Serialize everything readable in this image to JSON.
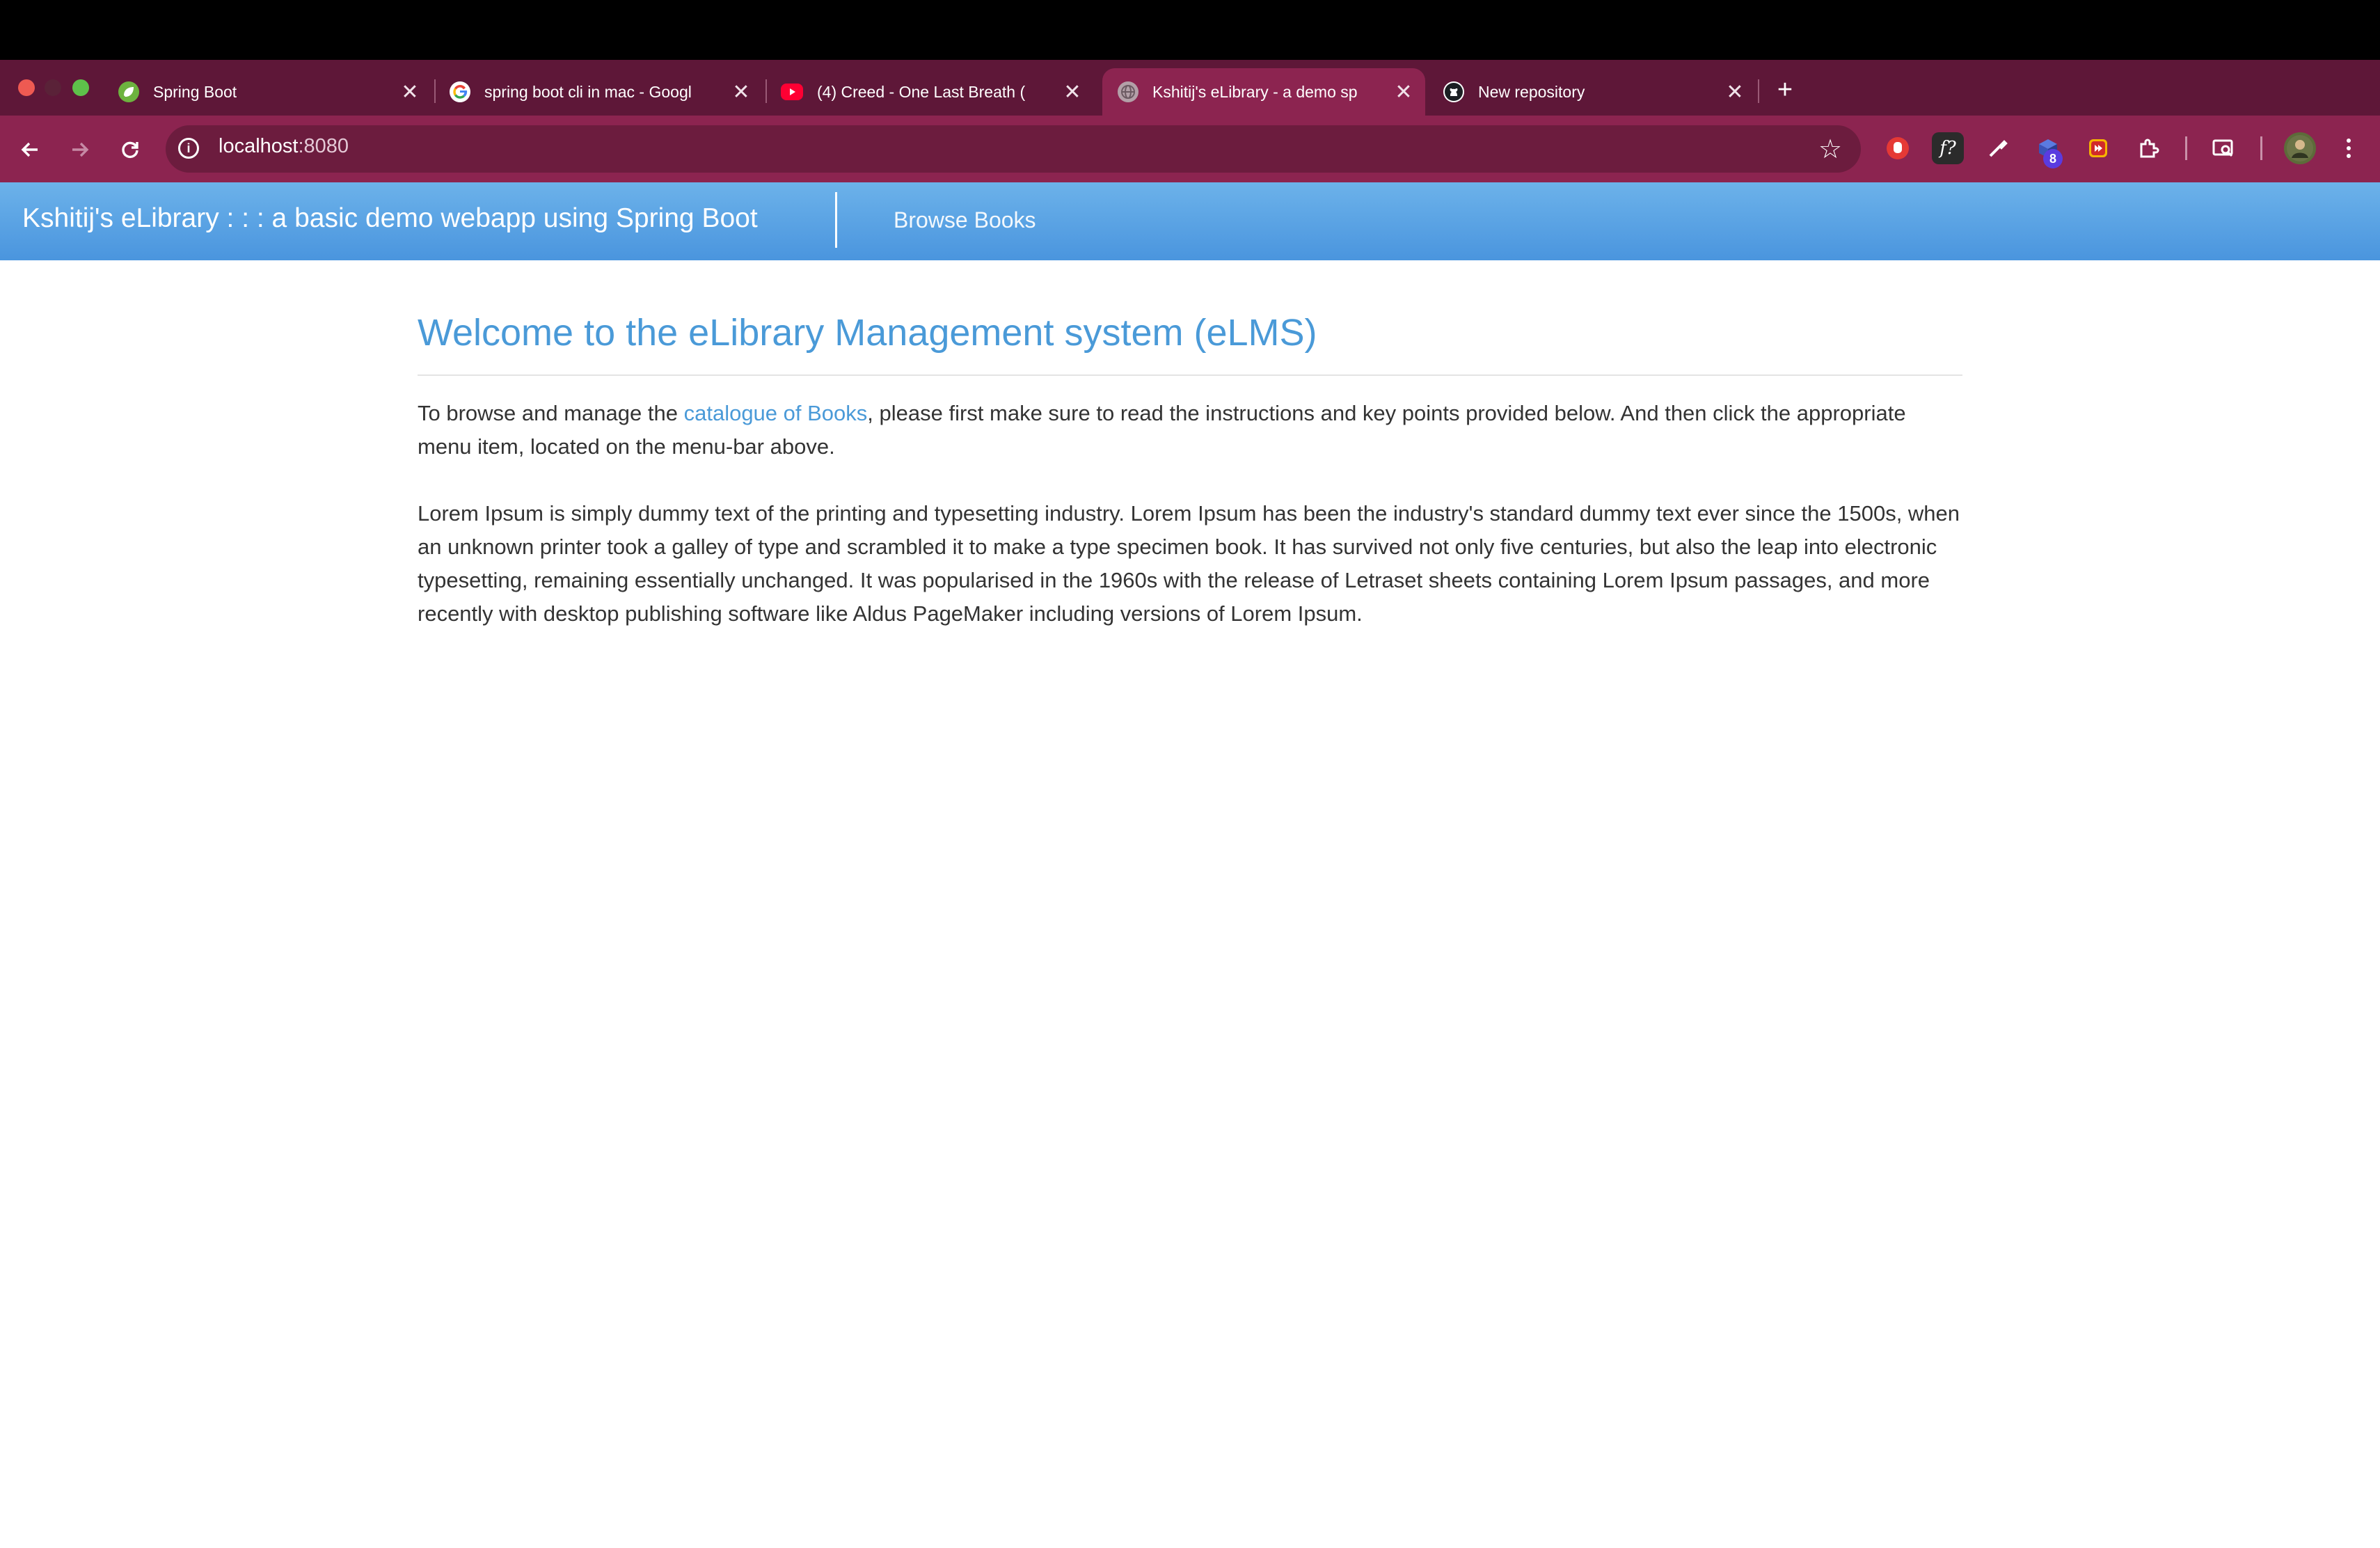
{
  "browser": {
    "tabs": [
      {
        "title": "Spring Boot",
        "favicon": "spring-icon",
        "active": false
      },
      {
        "title": "spring boot cli in mac - Googl",
        "favicon": "google-icon",
        "active": false
      },
      {
        "title": "(4) Creed - One Last Breath (",
        "favicon": "youtube-icon",
        "active": false
      },
      {
        "title": "Kshitij's eLibrary - a demo sp",
        "favicon": "globe-icon",
        "active": true
      },
      {
        "title": "New repository",
        "favicon": "github-icon",
        "active": false
      }
    ],
    "close_glyph": "✕",
    "new_tab_glyph": "+",
    "address": {
      "host": "localhost",
      "port": ":8080"
    },
    "extension_badge": "8",
    "colors": {
      "tabbar": "#5e1738",
      "toolbar": "#8c2450",
      "omnibox": "#6c1c3e"
    }
  },
  "app": {
    "brand": "Kshitij's eLibrary : : : a basic demo webapp using Spring Boot",
    "nav_link": "Browse Books",
    "colors": {
      "navbar_top": "#6cb2ea",
      "navbar_bottom": "#4a95de",
      "heading": "#4a9ad8"
    }
  },
  "main": {
    "heading": "Welcome to the eLibrary Management system (eLMS)",
    "intro_before": "To browse and manage the ",
    "intro_link": "catalogue of Books",
    "intro_after": ", please first make sure to read the instructions and key points provided below. And then click the appropriate menu item, located on the menu-bar above.",
    "lorem": "Lorem Ipsum is simply dummy text of the printing and typesetting industry. Lorem Ipsum has been the industry's standard dummy text ever since the 1500s, when an unknown printer took a galley of type and scrambled it to make a type specimen book. It has survived not only five centuries, but also the leap into electronic typesetting, remaining essentially unchanged. It was popularised in the 1960s with the release of Letraset sheets containing Lorem Ipsum passages, and more recently with desktop publishing software like Aldus PageMaker including versions of Lorem Ipsum."
  }
}
